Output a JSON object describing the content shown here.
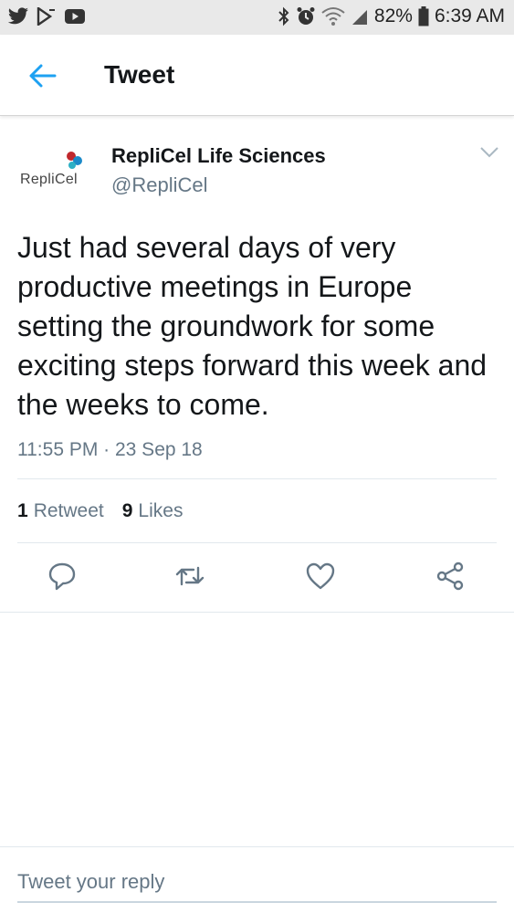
{
  "status_bar": {
    "battery": "82%",
    "time": "6:39 AM"
  },
  "header": {
    "title": "Tweet"
  },
  "tweet": {
    "avatar_text": "RepliCel",
    "display_name": "RepliCel Life Sciences",
    "handle": "@RepliCel",
    "text": "Just had several days of very productive meetings in Europe setting the groundwork for some exciting steps forward this week and the weeks to come.",
    "timestamp": "11:55 PM · 23 Sep 18",
    "retweet_count": "1",
    "retweet_label": "Retweet",
    "like_count": "9",
    "like_label": "Likes"
  },
  "reply": {
    "placeholder": "Tweet your reply"
  },
  "colors": {
    "accent": "#1da1f2",
    "secondary_text": "#657786"
  }
}
